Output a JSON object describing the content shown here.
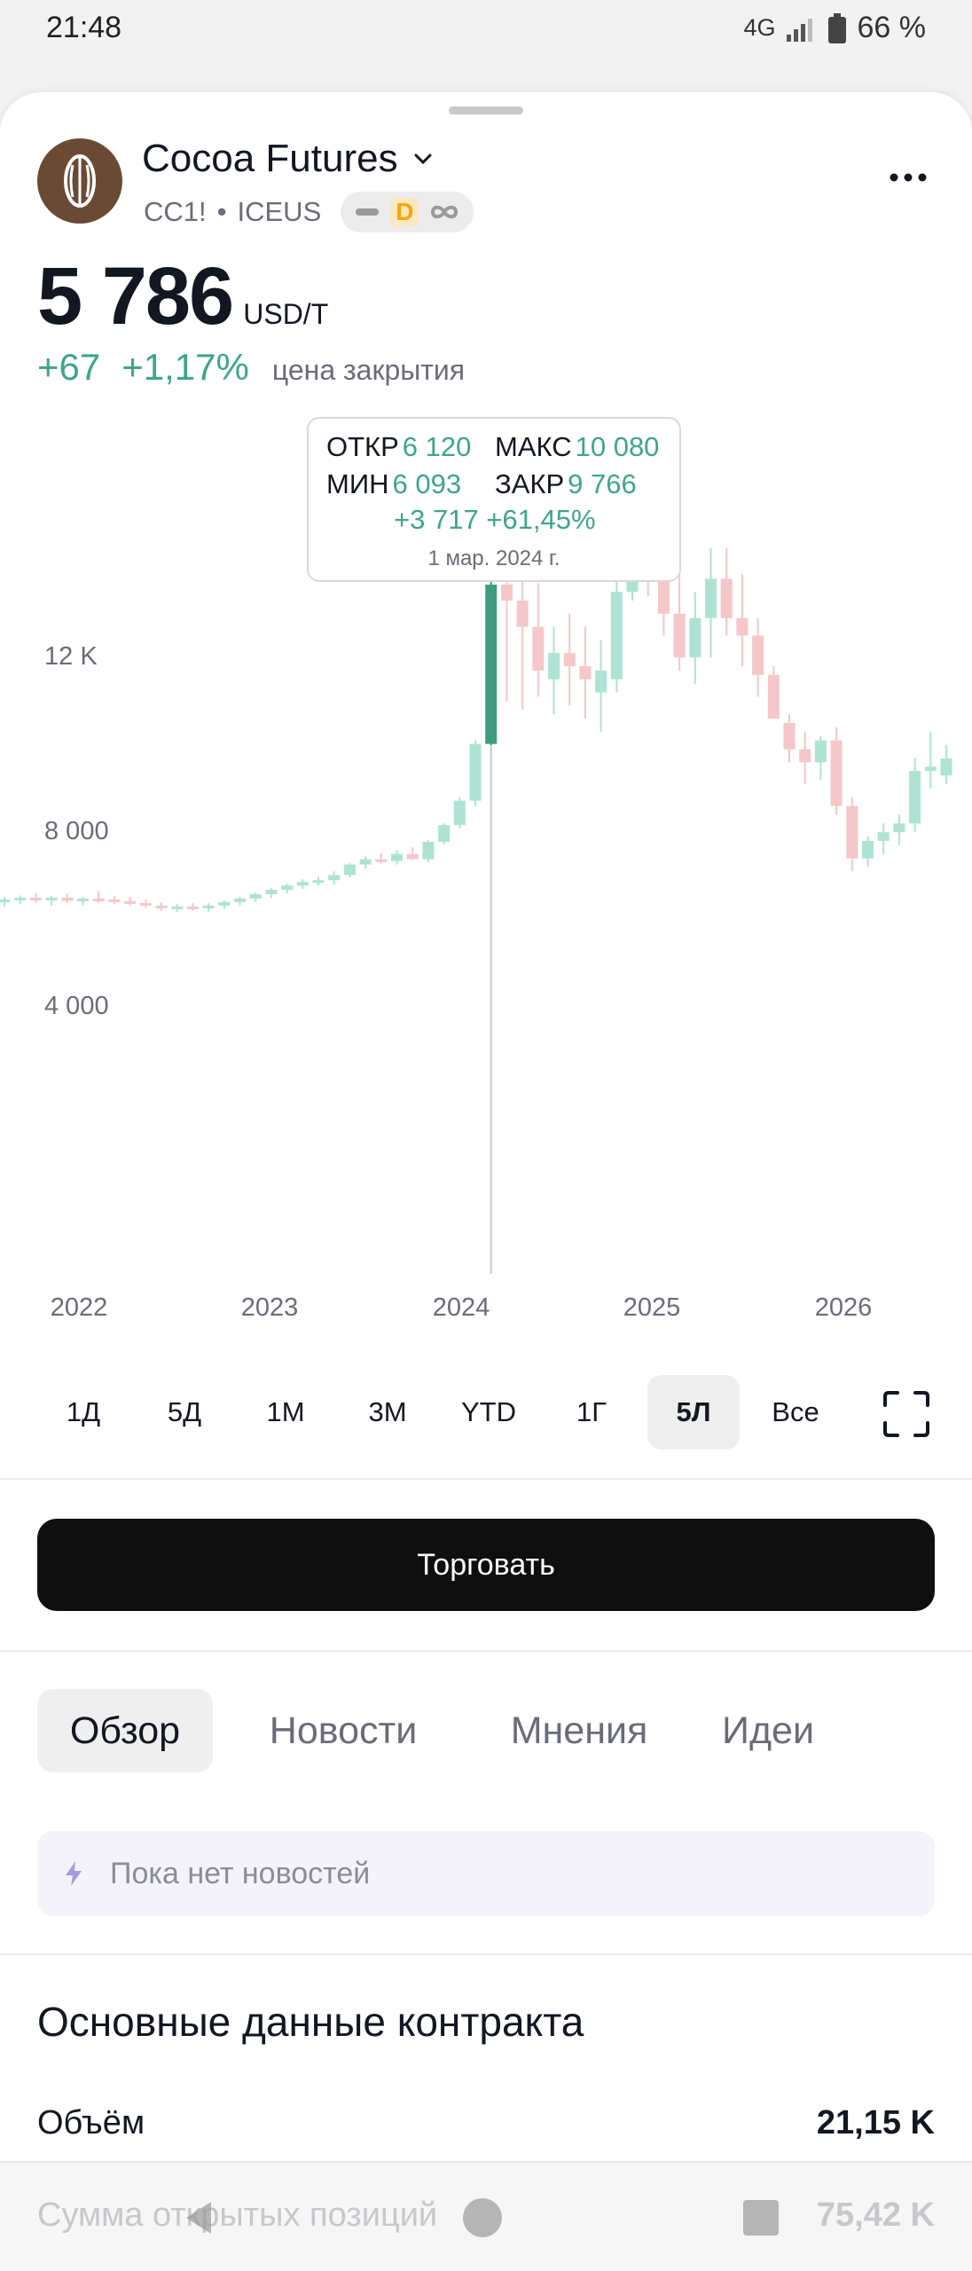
{
  "status_bar": {
    "time": "21:48",
    "network": "4G",
    "battery": "66 %"
  },
  "header": {
    "title": "Cocoa Futures",
    "symbol": "CC1!",
    "separator": "•",
    "exchange": "ICEUS",
    "badge_letter": "D"
  },
  "quote": {
    "price": "5 786",
    "unit": "USD/T",
    "change_abs": "+67",
    "change_pct": "+1,17%",
    "note": "цена закрытия"
  },
  "tooltip": {
    "open_label": "ОТКР",
    "open": "6 120",
    "high_label": "МАКС",
    "high": "10 080",
    "low_label": "МИН",
    "low": "6 093",
    "close_label": "ЗАКР",
    "close": "9 766",
    "change": "+3 717 +61,45%",
    "date": "1 мар. 2024 г."
  },
  "chart_data": {
    "type": "candlestick",
    "y_ticks": [
      "12 K",
      "8 000",
      "4 000"
    ],
    "x_ticks": [
      "2022",
      "2023",
      "2024",
      "2025",
      "2026"
    ],
    "colors": {
      "up": "#aee3d4",
      "down": "#f4c7c9",
      "highlight": "#3d9c7f"
    },
    "highlight_index": 31,
    "series": [
      {
        "o": 2520,
        "h": 2620,
        "l": 2400,
        "c": 2560
      },
      {
        "o": 2560,
        "h": 2650,
        "l": 2460,
        "c": 2600
      },
      {
        "o": 2600,
        "h": 2700,
        "l": 2480,
        "c": 2540
      },
      {
        "o": 2540,
        "h": 2640,
        "l": 2420,
        "c": 2600
      },
      {
        "o": 2600,
        "h": 2690,
        "l": 2480,
        "c": 2530
      },
      {
        "o": 2530,
        "h": 2620,
        "l": 2420,
        "c": 2580
      },
      {
        "o": 2580,
        "h": 2750,
        "l": 2480,
        "c": 2560
      },
      {
        "o": 2560,
        "h": 2640,
        "l": 2460,
        "c": 2520
      },
      {
        "o": 2520,
        "h": 2620,
        "l": 2420,
        "c": 2480
      },
      {
        "o": 2480,
        "h": 2560,
        "l": 2360,
        "c": 2420
      },
      {
        "o": 2420,
        "h": 2500,
        "l": 2300,
        "c": 2360
      },
      {
        "o": 2360,
        "h": 2460,
        "l": 2280,
        "c": 2400
      },
      {
        "o": 2400,
        "h": 2480,
        "l": 2300,
        "c": 2360
      },
      {
        "o": 2360,
        "h": 2480,
        "l": 2280,
        "c": 2420
      },
      {
        "o": 2420,
        "h": 2540,
        "l": 2340,
        "c": 2500
      },
      {
        "o": 2500,
        "h": 2620,
        "l": 2420,
        "c": 2580
      },
      {
        "o": 2580,
        "h": 2720,
        "l": 2500,
        "c": 2680
      },
      {
        "o": 2680,
        "h": 2820,
        "l": 2600,
        "c": 2780
      },
      {
        "o": 2780,
        "h": 2920,
        "l": 2700,
        "c": 2880
      },
      {
        "o": 2880,
        "h": 3020,
        "l": 2800,
        "c": 2960
      },
      {
        "o": 2960,
        "h": 3080,
        "l": 2880,
        "c": 3000
      },
      {
        "o": 3000,
        "h": 3200,
        "l": 2900,
        "c": 3120
      },
      {
        "o": 3120,
        "h": 3400,
        "l": 3060,
        "c": 3360
      },
      {
        "o": 3360,
        "h": 3540,
        "l": 3260,
        "c": 3480
      },
      {
        "o": 3480,
        "h": 3620,
        "l": 3380,
        "c": 3440
      },
      {
        "o": 3440,
        "h": 3680,
        "l": 3360,
        "c": 3600
      },
      {
        "o": 3600,
        "h": 3760,
        "l": 3460,
        "c": 3480
      },
      {
        "o": 3480,
        "h": 3920,
        "l": 3420,
        "c": 3880
      },
      {
        "o": 3880,
        "h": 4300,
        "l": 3820,
        "c": 4260
      },
      {
        "o": 4260,
        "h": 4900,
        "l": 4180,
        "c": 4820
      },
      {
        "o": 4820,
        "h": 6200,
        "l": 4700,
        "c": 6120
      },
      {
        "o": 6120,
        "h": 10080,
        "l": 6093,
        "c": 9766
      },
      {
        "o": 9766,
        "h": 11600,
        "l": 7100,
        "c": 9400
      },
      {
        "o": 9400,
        "h": 10200,
        "l": 6900,
        "c": 8800
      },
      {
        "o": 8800,
        "h": 9800,
        "l": 7200,
        "c": 7800
      },
      {
        "o": 7600,
        "h": 8800,
        "l": 6800,
        "c": 8200
      },
      {
        "o": 8200,
        "h": 9100,
        "l": 7000,
        "c": 7900
      },
      {
        "o": 7900,
        "h": 8800,
        "l": 6700,
        "c": 7600
      },
      {
        "o": 7300,
        "h": 8500,
        "l": 6400,
        "c": 7800
      },
      {
        "o": 7600,
        "h": 9900,
        "l": 7300,
        "c": 9600
      },
      {
        "o": 9600,
        "h": 13000,
        "l": 9400,
        "c": 11600
      },
      {
        "o": 11600,
        "h": 12400,
        "l": 9500,
        "c": 10900
      },
      {
        "o": 10900,
        "h": 11300,
        "l": 8600,
        "c": 9100
      },
      {
        "o": 9100,
        "h": 10100,
        "l": 7800,
        "c": 8100
      },
      {
        "o": 8100,
        "h": 9600,
        "l": 7500,
        "c": 9000
      },
      {
        "o": 9000,
        "h": 10600,
        "l": 8100,
        "c": 9900
      },
      {
        "o": 9900,
        "h": 10600,
        "l": 8600,
        "c": 9000
      },
      {
        "o": 9000,
        "h": 10000,
        "l": 7900,
        "c": 8600
      },
      {
        "o": 8600,
        "h": 9000,
        "l": 7200,
        "c": 7700
      },
      {
        "o": 7700,
        "h": 7900,
        "l": 6700,
        "c": 6700
      },
      {
        "o": 6600,
        "h": 6800,
        "l": 5700,
        "c": 6000
      },
      {
        "o": 6000,
        "h": 6400,
        "l": 5200,
        "c": 5700
      },
      {
        "o": 5700,
        "h": 6300,
        "l": 5300,
        "c": 6200
      },
      {
        "o": 6200,
        "h": 6500,
        "l": 4500,
        "c": 4700
      },
      {
        "o": 4700,
        "h": 4900,
        "l": 3200,
        "c": 3500
      },
      {
        "o": 3500,
        "h": 4000,
        "l": 3300,
        "c": 3900
      },
      {
        "o": 3900,
        "h": 4300,
        "l": 3600,
        "c": 4100
      },
      {
        "o": 4100,
        "h": 4500,
        "l": 3800,
        "c": 4300
      },
      {
        "o": 4300,
        "h": 5800,
        "l": 4100,
        "c": 5500
      },
      {
        "o": 5500,
        "h": 6400,
        "l": 5100,
        "c": 5600
      },
      {
        "o": 5400,
        "h": 6100,
        "l": 5200,
        "c": 5786
      }
    ]
  },
  "ranges": [
    "1Д",
    "5Д",
    "1М",
    "3М",
    "YTD",
    "1Г",
    "5Л",
    "Все"
  ],
  "active_range": "5Л",
  "trade_button": "Торговать",
  "tabs": [
    "Обзор",
    "Новости",
    "Мнения",
    "Идеи"
  ],
  "active_tab": "Обзор",
  "news_empty": "Пока нет новостей",
  "contract": {
    "title": "Основные данные контракта",
    "rows": [
      {
        "label": "Объём",
        "value": "21,15 K"
      },
      {
        "label": "Сумма открытых позиций",
        "value": "75,42 K"
      }
    ]
  }
}
